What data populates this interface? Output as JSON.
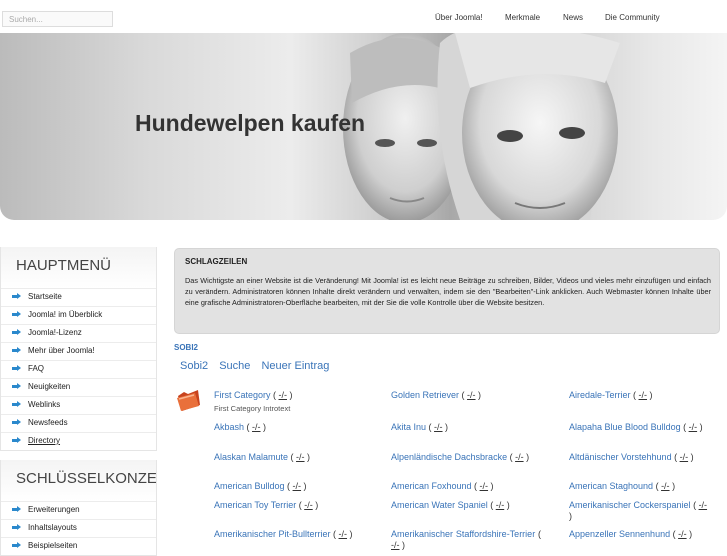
{
  "search": {
    "placeholder": "Suchen..."
  },
  "topnav": [
    "Über Joomla!",
    "Merkmale",
    "News",
    "Die Community"
  ],
  "hero": {
    "title": "Hundewelpen kaufen"
  },
  "sidebar": {
    "main_menu": {
      "title": "HAUPTMENÜ",
      "items": [
        "Startseite",
        "Joomla! im Überblick",
        "Joomla!-Lizenz",
        "Mehr über Joomla!",
        "FAQ",
        "Neuigkeiten",
        "Weblinks",
        "Newsfeeds",
        "Directory"
      ]
    },
    "concepts": {
      "title": "SCHLÜSSELKONZEPTE",
      "items": [
        "Erweiterungen",
        "Inhaltslayouts",
        "Beispielseiten"
      ]
    }
  },
  "headlines": {
    "title": "SCHLAGZEILEN",
    "body": "Das Wichtigste an einer Website ist die Veränderung! Mit Joomla! ist es leicht neue Beiträge zu schreiben, Bilder, Videos und vieles mehr einzufügen und einfach zu verändern. Administratoren können Inhalte direkt verändern und verwalten, indem sie den \"Bearbeiten\"-Link anklicken. Auch Webmaster können Inhalte über eine grafische Administratoren-Oberfläche bearbeiten, mit der Sie die volle Kontrolle über die Website besitzen."
  },
  "sobi": {
    "label": "SOBI2",
    "nav": [
      "Sobi2",
      "Suche",
      "Neuer Eintrag"
    ],
    "count_label": "-/-",
    "first_intro": "First Category Introtext",
    "categories": [
      [
        "First Category",
        "Golden Retriever",
        "Airedale-Terrier"
      ],
      [
        "Akbash",
        "Akita Inu",
        "Alapaha Blue Blood Bulldog"
      ],
      [
        "Alaskan Malamute",
        "Alpenländische Dachsbracke",
        "Altdänischer Vorstehhund"
      ],
      [
        "American Bulldog",
        "American Foxhound",
        "American Staghound"
      ],
      [
        "American Toy Terrier",
        "American Water Spaniel",
        "Amerikanischer Cockerspaniel"
      ],
      [
        "Amerikanischer Pit-Bullterrier",
        "Amerikanischer Staffordshire-Terrier",
        "Appenzeller Sennenhund"
      ]
    ]
  }
}
